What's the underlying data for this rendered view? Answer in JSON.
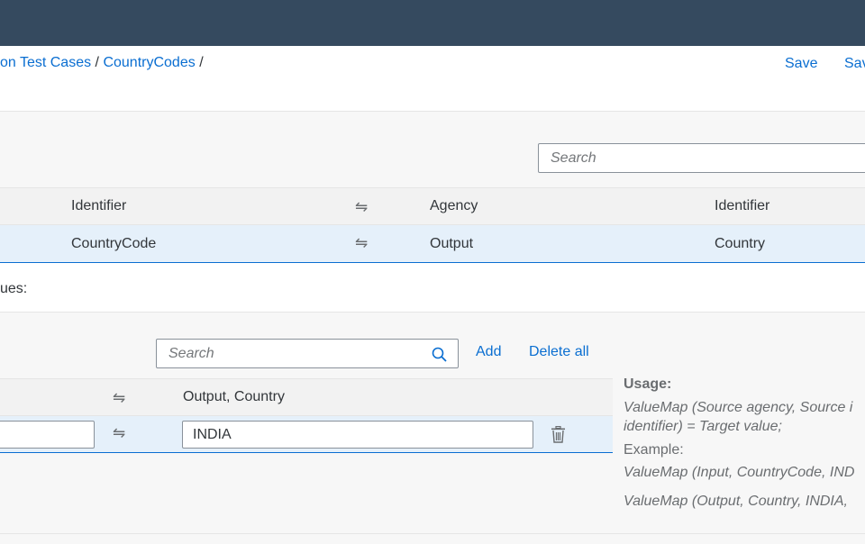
{
  "header": {
    "breadcrumb": [
      {
        "label": "on Test Cases"
      },
      {
        "label": "CountryCodes"
      }
    ],
    "separator": "/",
    "save_label": "Save",
    "save_as_label": "Sav"
  },
  "agencies": {
    "search_placeholder": "Search",
    "columns": {
      "identifier_left": "Identifier",
      "agency": "Agency",
      "identifier_right": "Identifier"
    },
    "row": {
      "identifier_left": "CountryCode",
      "agency": "Output",
      "identifier_right": "Country"
    }
  },
  "values_label": "ues:",
  "values": {
    "search_placeholder": "Search",
    "add_label": "Add",
    "delete_all_label": "Delete all",
    "column_target": "Output, Country",
    "row": {
      "source": "",
      "target": "INDIA"
    }
  },
  "usage": {
    "title": "Usage:",
    "syntax_line1": "ValueMap (Source agency, Source i",
    "syntax_line2": "identifier) = Target value;",
    "example_label": "Example:",
    "example1": "ValueMap (Input, CountryCode, IND",
    "example2": "ValueMap (Output, Country, INDIA,"
  },
  "icons": {
    "swap": "⇋",
    "search": "search-icon",
    "delete": "trash-icon"
  },
  "colors": {
    "shell": "#354a5f",
    "link": "#0a6ed1",
    "selected_row": "#e5f0fa"
  }
}
